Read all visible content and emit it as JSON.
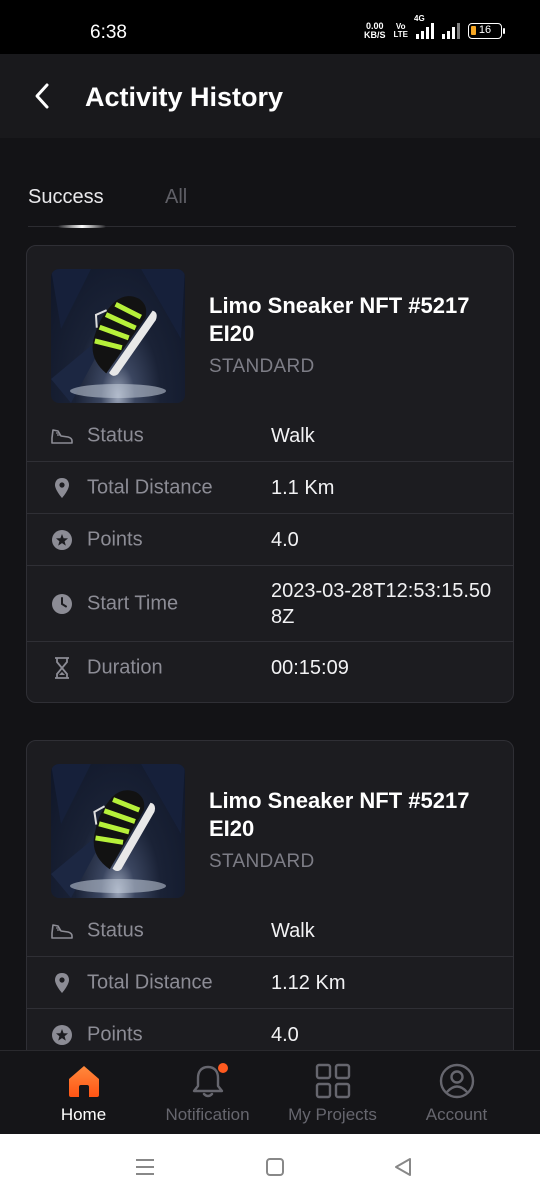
{
  "status_bar": {
    "time": "6:38",
    "net_speed_value": "0.00",
    "net_speed_unit": "KB/S",
    "volte_top": "Vo",
    "volte_bottom": "LTE",
    "network": "4G",
    "battery": "16"
  },
  "header": {
    "title": "Activity History",
    "back_icon": "chevron-left-icon"
  },
  "tabs": {
    "success": "Success",
    "all": "All",
    "active": "success"
  },
  "activities": [
    {
      "name": "Limo Sneaker NFT #5217 EI20",
      "grade": "STANDARD",
      "rows": [
        {
          "icon": "sneaker-icon",
          "label": "Status",
          "value": "Walk"
        },
        {
          "icon": "map-pin-icon",
          "label": "Total Distance",
          "value": "1.1 Km"
        },
        {
          "icon": "points-icon",
          "label": "Points",
          "value": "4.0"
        },
        {
          "icon": "clock-icon",
          "label": "Start Time",
          "value": "2023-03-28T12:53:15.508Z"
        },
        {
          "icon": "hourglass-icon",
          "label": "Duration",
          "value": "00:15:09"
        }
      ]
    },
    {
      "name": "Limo Sneaker NFT #5217 EI20",
      "grade": "STANDARD",
      "rows": [
        {
          "icon": "sneaker-icon",
          "label": "Status",
          "value": "Walk"
        },
        {
          "icon": "map-pin-icon",
          "label": "Total Distance",
          "value": "1.12 Km"
        },
        {
          "icon": "points-icon",
          "label": "Points",
          "value": "4.0"
        }
      ]
    }
  ],
  "bottom_nav": [
    {
      "label": "Home",
      "icon": "home-icon",
      "active": true
    },
    {
      "label": "Notification",
      "icon": "bell-icon",
      "active": false,
      "badge": true
    },
    {
      "label": "My Projects",
      "icon": "grid-icon",
      "active": false
    },
    {
      "label": "Account",
      "icon": "user-circle-icon",
      "active": false
    }
  ],
  "colors": {
    "background": "#131316",
    "card": "#1c1c20",
    "accent": "#ff6a1f",
    "sneaker_green": "#b6f03a"
  }
}
